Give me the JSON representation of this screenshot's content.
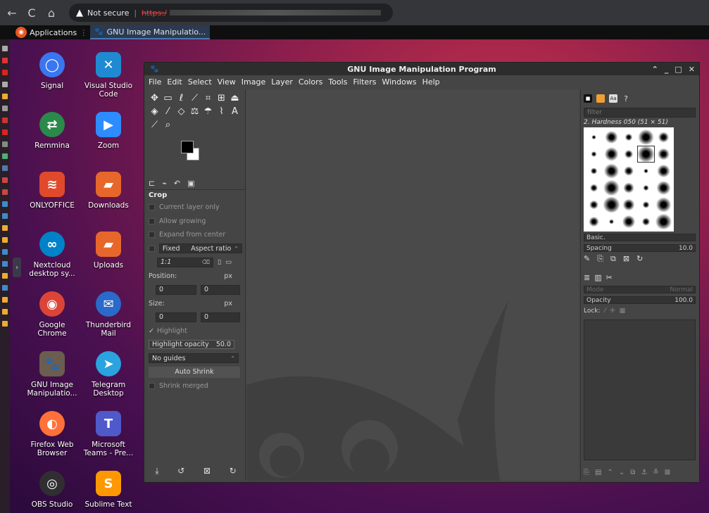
{
  "browser": {
    "back": "←",
    "forward": "C",
    "home": "⌂",
    "security_label": "Not secure",
    "url_scheme": "https"
  },
  "taskbar": {
    "apps_label": "Applications",
    "task_label": "GNU Image Manipulatio..."
  },
  "desktop": {
    "icons": [
      {
        "label": "Signal",
        "icon": "signal-icon",
        "color": "#3a76f0"
      },
      {
        "label": "Visual Studio Code",
        "icon": "vscode-icon",
        "color": "#1f8ad2"
      },
      {
        "label": "Remmina",
        "icon": "remmina-icon",
        "color": "#2a8a4a"
      },
      {
        "label": "Zoom",
        "icon": "zoom-icon",
        "color": "#2d8cff"
      },
      {
        "label": "ONLYOFFICE",
        "icon": "onlyoffice-icon",
        "color": "#e04a2a"
      },
      {
        "label": "Downloads",
        "icon": "folder-icon",
        "color": "#e7672b"
      },
      {
        "label": "Nextcloud desktop sy...",
        "icon": "nextcloud-icon",
        "color": "#0082c9"
      },
      {
        "label": "Uploads",
        "icon": "folder-icon",
        "color": "#e7672b"
      },
      {
        "label": "Google Chrome",
        "icon": "chrome-icon",
        "color": "#db4437"
      },
      {
        "label": "Thunderbird Mail",
        "icon": "thunderbird-icon",
        "color": "#2a6acb"
      },
      {
        "label": "GNU Image Manipulatio...",
        "icon": "gimp-icon",
        "color": "#6b5d4f"
      },
      {
        "label": "Telegram Desktop",
        "icon": "telegram-icon",
        "color": "#2aa3df"
      },
      {
        "label": "Firefox Web Browser",
        "icon": "firefox-icon",
        "color": "#ff7139"
      },
      {
        "label": "Microsoft Teams - Pre...",
        "icon": "teams-icon",
        "color": "#5059c9"
      },
      {
        "label": "OBS Studio",
        "icon": "obs-icon",
        "color": "#302e31"
      },
      {
        "label": "Sublime Text",
        "icon": "sublime-icon",
        "color": "#ff9800"
      }
    ]
  },
  "gimp": {
    "title": "GNU Image Manipulation Program",
    "menu": [
      "File",
      "Edit",
      "Select",
      "View",
      "Image",
      "Layer",
      "Colors",
      "Tools",
      "Filters",
      "Windows",
      "Help"
    ],
    "tool_options": {
      "header": "Crop",
      "current_layer_only": "Current layer only",
      "allow_growing": "Allow growing",
      "expand_from_center": "Expand from center",
      "fixed": "Fixed",
      "aspect_ratio": "Aspect ratio",
      "ratio_value": "1:1",
      "position_label": "Position:",
      "unit": "px",
      "pos_x": "0",
      "pos_y": "0",
      "size_label": "Size:",
      "size_x": "0",
      "size_y": "0",
      "highlight": "Highlight",
      "highlight_opacity_label": "Highlight opacity",
      "highlight_opacity": "50.0",
      "guides": "No guides",
      "auto_shrink": "Auto Shrink",
      "shrink_merged": "Shrink merged"
    },
    "brushes": {
      "filter_placeholder": "filter",
      "brush_name": "2. Hardness 050 (51 × 51)",
      "preset": "Basic.",
      "spacing_label": "Spacing",
      "spacing": "10.0"
    },
    "layers": {
      "mode_label": "Mode",
      "mode": "Normal",
      "opacity_label": "Opacity",
      "opacity": "100.0",
      "lock_label": "Lock:"
    }
  }
}
